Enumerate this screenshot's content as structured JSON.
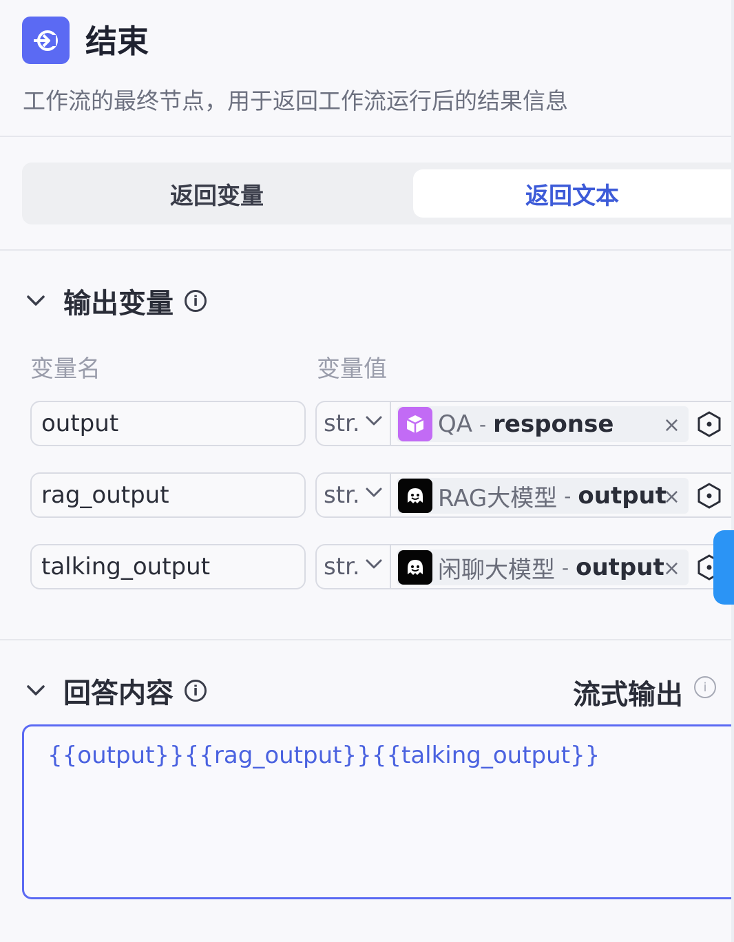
{
  "header": {
    "title": "结束",
    "description": "工作流的最终节点，用于返回工作流运行后的结果信息",
    "icon": "exit-icon"
  },
  "tabs": [
    {
      "label": "返回变量",
      "active": false
    },
    {
      "label": "返回文本",
      "active": true
    }
  ],
  "output_section": {
    "title": "输出变量",
    "col_name": "变量名",
    "col_value": "变量值",
    "rows": [
      {
        "name": "output",
        "type": "str.",
        "node": "QA",
        "separator": "-",
        "field": "response",
        "node_icon": "cube-icon"
      },
      {
        "name": "rag_output",
        "type": "str.",
        "node": "RAG大模型",
        "separator": "-",
        "field": "output",
        "node_icon": "bot-icon"
      },
      {
        "name": "talking_output",
        "type": "str.",
        "node": "闲聊大模型",
        "separator": "-",
        "field": "output",
        "node_icon": "bot-icon"
      }
    ],
    "close_glyph": "×"
  },
  "answer_section": {
    "title": "回答内容",
    "stream_label": "流式输出",
    "content": "{{output}}{{rag_output}}{{talking_output}}"
  },
  "colors": {
    "accent": "#5b6af3",
    "active_tab_text": "#3d5bd8",
    "qa_icon_bg": "#c26bf5",
    "side_tab": "#2b94f5"
  }
}
